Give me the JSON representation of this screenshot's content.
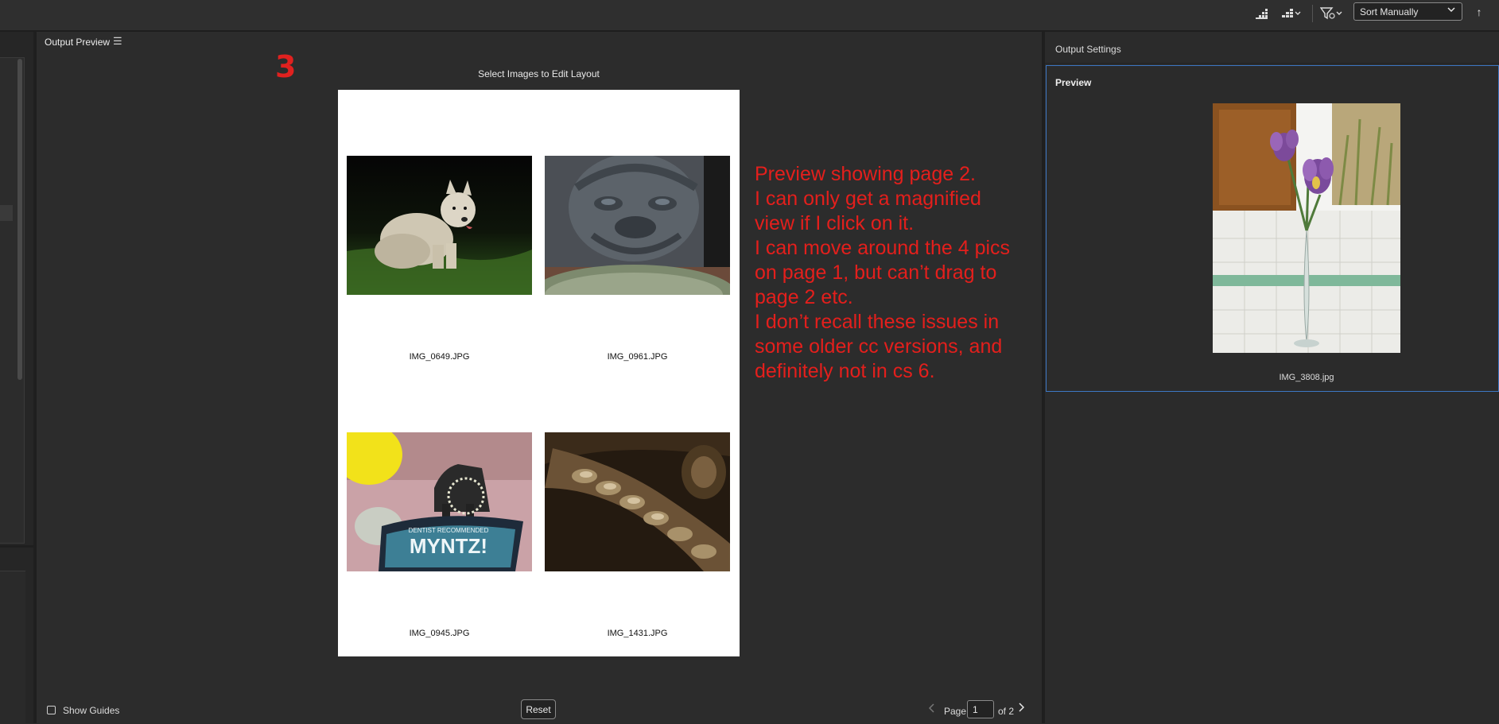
{
  "toolbar": {
    "icons": [
      "thumbnail-size-small-icon",
      "thumbnail-size-large-icon",
      "filter-icon"
    ],
    "sort": {
      "selected": "Sort Manually"
    },
    "sort_direction_icon": "↑"
  },
  "output_preview": {
    "title": "Output Preview",
    "menu_icon": "☰",
    "edit_hint": "Select Images to Edit Layout",
    "annotation_number": "3",
    "page_images": [
      {
        "filename": "IMG_0649.JPG",
        "subject": "white terrier dog"
      },
      {
        "filename": "IMG_0961.JPG",
        "subject": "stone dog statue"
      },
      {
        "filename": "IMG_0945.JPG",
        "subject": "scottie figurine on mint tin"
      },
      {
        "filename": "IMG_1431.JPG",
        "subject": "seed pod close-up"
      }
    ],
    "annotation_lines": [
      "Preview showing page 2.",
      "I can only get a magnified",
      "view if I click on it.",
      "I can move around the 4 pics",
      "on page 1, but can’t drag to",
      "page 2 etc.",
      "I don’t recall these issues in",
      "some older cc versions, and",
      "definitely not in cs 6."
    ],
    "show_guides": {
      "label": "Show Guides",
      "checked": false
    },
    "reset_label": "Reset",
    "pagination": {
      "page_label": "Page",
      "current_page": "1",
      "of_label": "of 2"
    }
  },
  "output_settings": {
    "title": "Output Settings",
    "preview_label": "Preview",
    "preview_image": {
      "filename": "IMG_3808.jpg",
      "subject": "purple iris in glass vase"
    }
  },
  "colors": {
    "annotation": "#e41f1c",
    "selection_border": "#3d77c4",
    "background": "#2b2b2b"
  }
}
